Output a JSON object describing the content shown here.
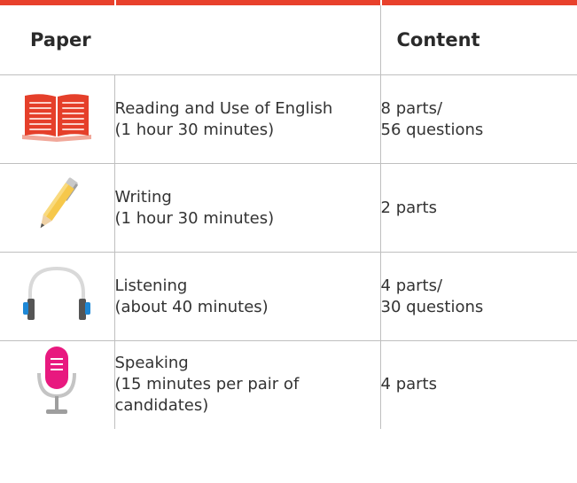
{
  "header": {
    "paper": "Paper",
    "content": "Content"
  },
  "rows": [
    {
      "icon": "open-book-icon",
      "name": [
        "Reading and Use of English",
        "(1 hour 30 minutes)"
      ],
      "content": [
        "8 parts/",
        "56 questions"
      ]
    },
    {
      "icon": "pen-icon",
      "name": [
        "Writing",
        "(1 hour 30 minutes)"
      ],
      "content": [
        "2 parts"
      ]
    },
    {
      "icon": "headphones-icon",
      "name": [
        "Listening",
        "(about 40 minutes)"
      ],
      "content": [
        "4 parts/",
        "30 questions"
      ]
    },
    {
      "icon": "microphone-icon",
      "name": [
        "Speaking",
        "(15 minutes per pair of",
        "candidates)"
      ],
      "content": [
        "4 parts"
      ]
    }
  ],
  "colors": {
    "accent_red": "#e8412c",
    "book_red": "#e53f2a",
    "pen_yellow": "#f6c84b",
    "headphone_blue": "#1e88d6",
    "mic_magenta": "#e8197f"
  }
}
